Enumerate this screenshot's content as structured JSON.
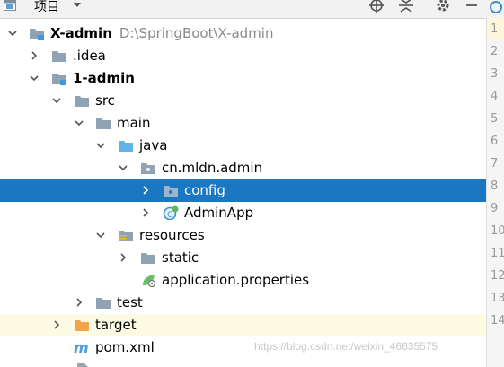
{
  "toolbar": {
    "title": "项目",
    "icons": [
      "project-icon",
      "dropdown-icon",
      "locate-icon",
      "collapse-icon",
      "settings-icon",
      "minimize-icon"
    ]
  },
  "tree": {
    "root": {
      "name": "X-admin",
      "path": "D:\\SpringBoot\\X-admin"
    },
    "idea": ".idea",
    "module": "1-admin",
    "src": "src",
    "main": "main",
    "java": "java",
    "package": "cn.mldn.admin",
    "config": "config",
    "adminapp": "AdminApp",
    "resources": "resources",
    "static": "static",
    "props": "application.properties",
    "test": "test",
    "target": "target",
    "pom": "pom.xml"
  },
  "gutter": [
    "1",
    "2",
    "3",
    "4",
    "5",
    "6",
    "7",
    "8",
    "9",
    "10",
    "11",
    "12",
    "13",
    "14"
  ],
  "watermark": "https://blog.csdn.net/weixin_46635575",
  "colors": {
    "selection": "#1a78c2",
    "folder": "#8fa3b5",
    "source_folder": "#62b3e8",
    "target_folder": "#f2a44a"
  }
}
